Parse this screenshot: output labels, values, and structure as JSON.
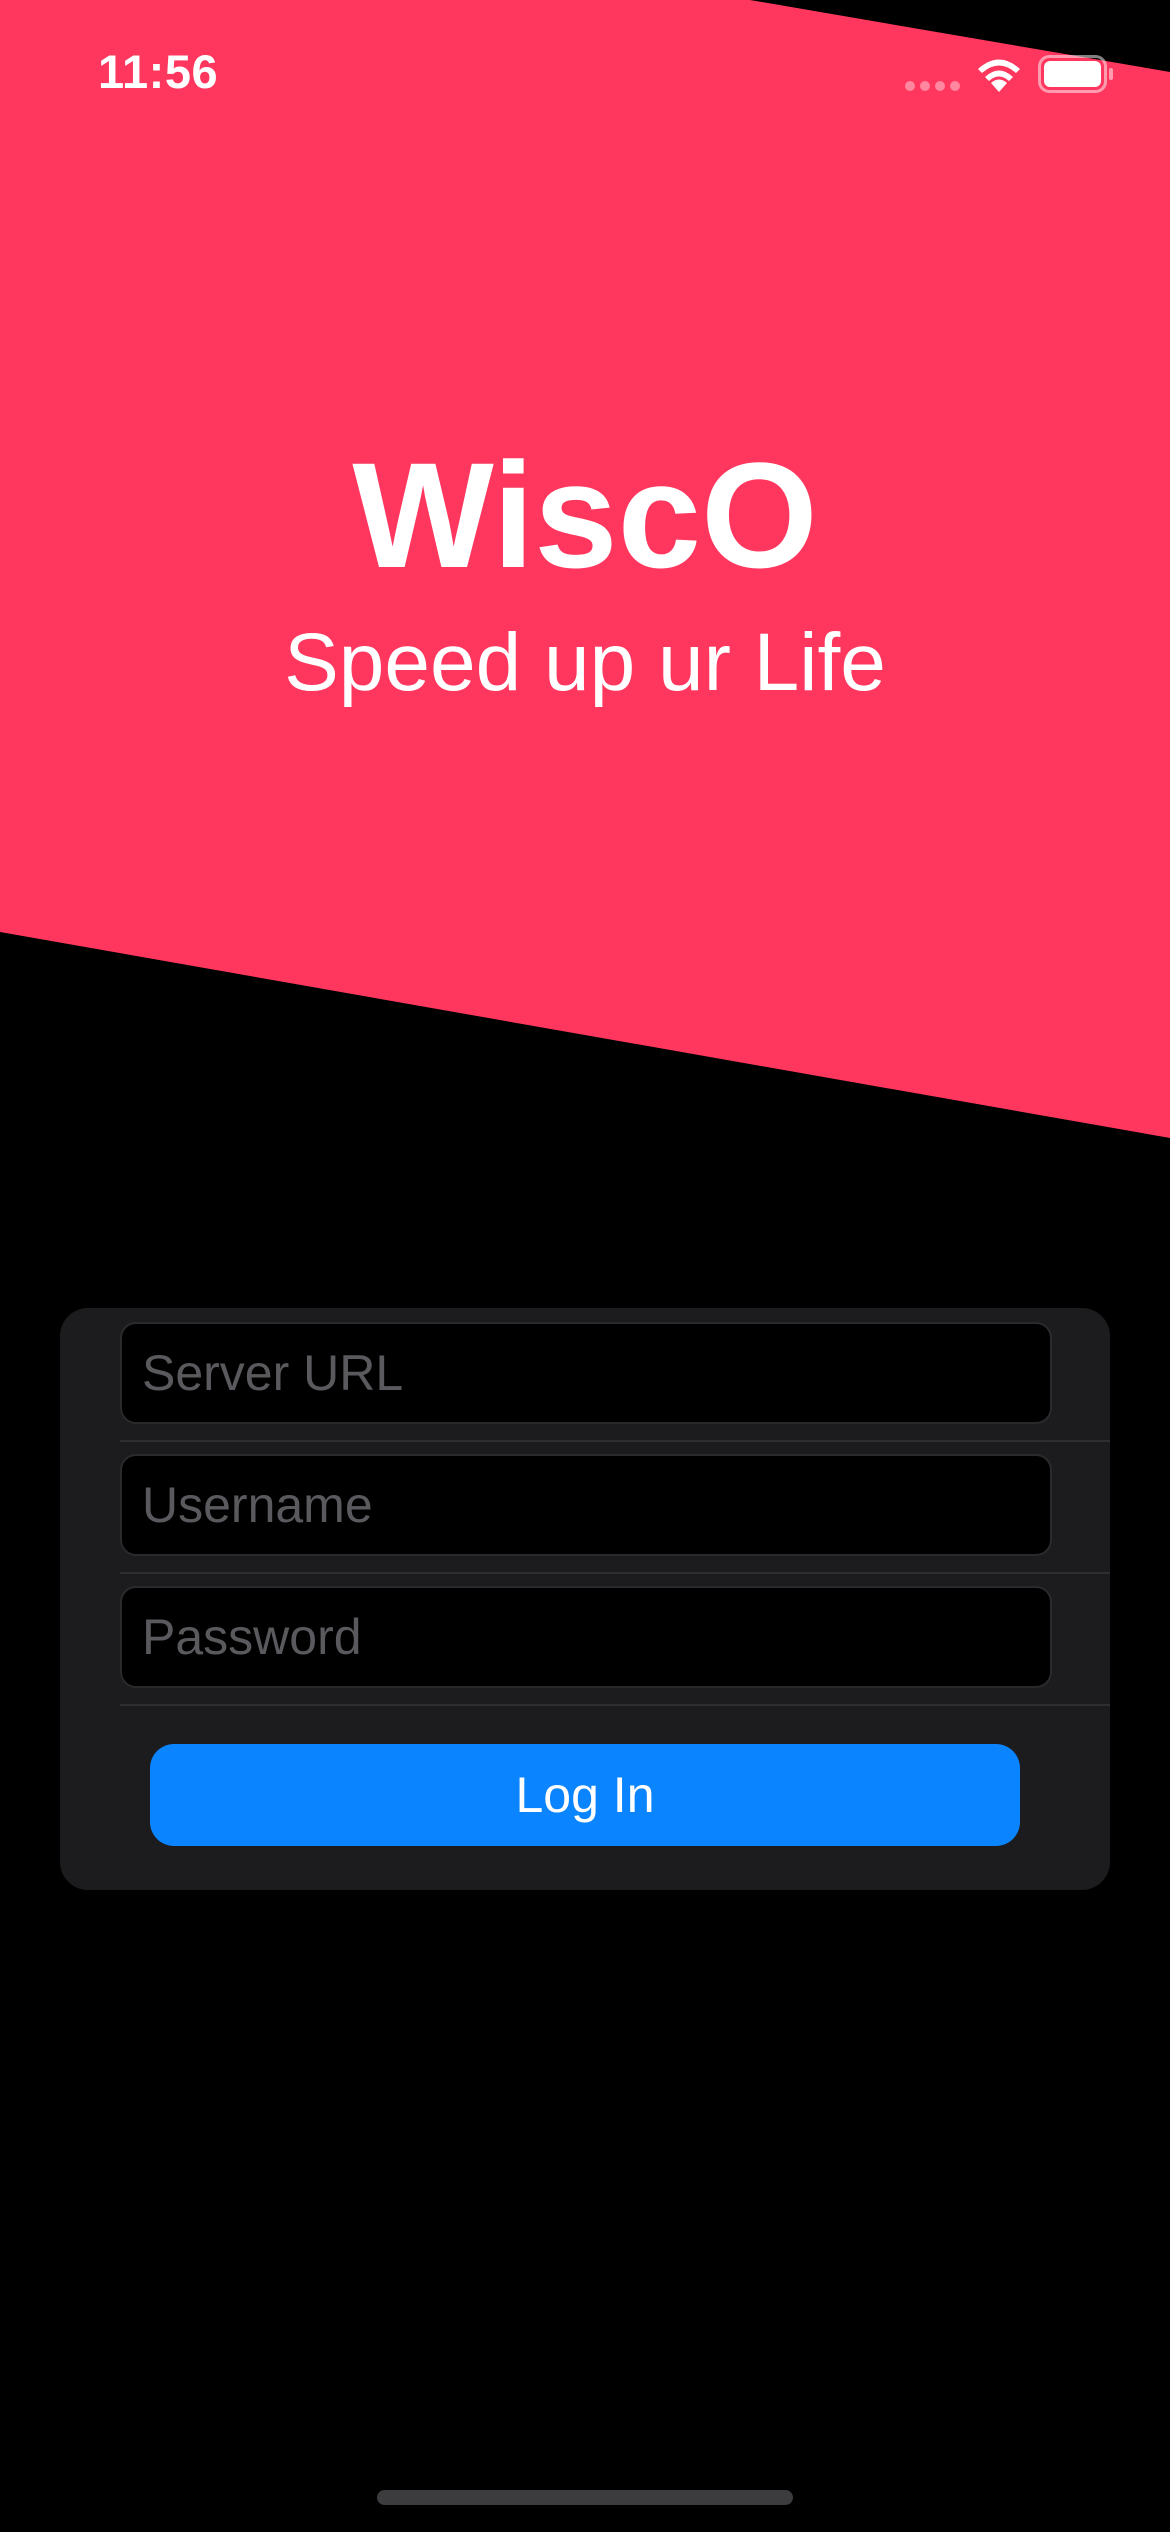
{
  "colors": {
    "hero": "#ff375f",
    "background": "#000000",
    "card": "#1c1c1e",
    "button": "#0a84ff",
    "placeholder": "#5a5a5e"
  },
  "status_bar": {
    "time": "11:56",
    "icons": [
      "signal-icon",
      "wifi-icon",
      "battery-icon"
    ]
  },
  "hero": {
    "title": "WiscO",
    "subtitle": "Speed up ur Life"
  },
  "login_form": {
    "server_url": {
      "placeholder": "Server URL",
      "value": ""
    },
    "username": {
      "placeholder": "Username",
      "value": ""
    },
    "password": {
      "placeholder": "Password",
      "value": ""
    },
    "login_label": "Log In"
  }
}
